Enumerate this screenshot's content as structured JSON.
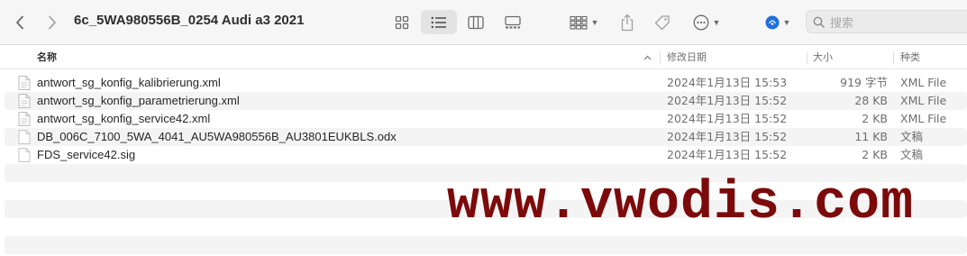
{
  "window": {
    "title": "6c_5WA980556B_0254 Audi a3 2021"
  },
  "toolbar": {
    "back_icon": "chevron-left",
    "forward_icon": "chevron-right",
    "view_modes": [
      "icon-view",
      "list-view",
      "column-view",
      "gallery-view"
    ],
    "active_view": "list-view",
    "group_icon": "group-grid",
    "share_icon": "share",
    "tag_icon": "tag",
    "more_icon": "ellipsis-circle",
    "airdrop_icon": "airdrop",
    "search_placeholder": "搜索"
  },
  "columns": {
    "name": "名称",
    "modified": "修改日期",
    "size": "大小",
    "kind": "种类"
  },
  "files": [
    {
      "name": "antwort_sg_konfig_kalibrierung.xml",
      "modified": "2024年1月13日 15:53",
      "size": "919 字节",
      "kind": "XML File",
      "icon": "xml-doc"
    },
    {
      "name": "antwort_sg_konfig_parametrierung.xml",
      "modified": "2024年1月13日 15:52",
      "size": "28 KB",
      "kind": "XML File",
      "icon": "xml-doc"
    },
    {
      "name": "antwort_sg_konfig_service42.xml",
      "modified": "2024年1月13日 15:52",
      "size": "2 KB",
      "kind": "XML File",
      "icon": "xml-doc"
    },
    {
      "name": "DB_006C_7100_5WA_4041_AU5WA980556B_AU3801EUKBLS.odx",
      "modified": "2024年1月13日 15:52",
      "size": "11 KB",
      "kind": "文稿",
      "icon": "blank-doc"
    },
    {
      "name": "FDS_service42.sig",
      "modified": "2024年1月13日 15:52",
      "size": "2 KB",
      "kind": "文稿",
      "icon": "blank-doc"
    }
  ],
  "watermark": {
    "text": "www.vwodis.com",
    "color": "#7c0a0a"
  },
  "colors": {
    "stripe": "#f4f4f5",
    "airdrop": "#1e6fe0"
  }
}
